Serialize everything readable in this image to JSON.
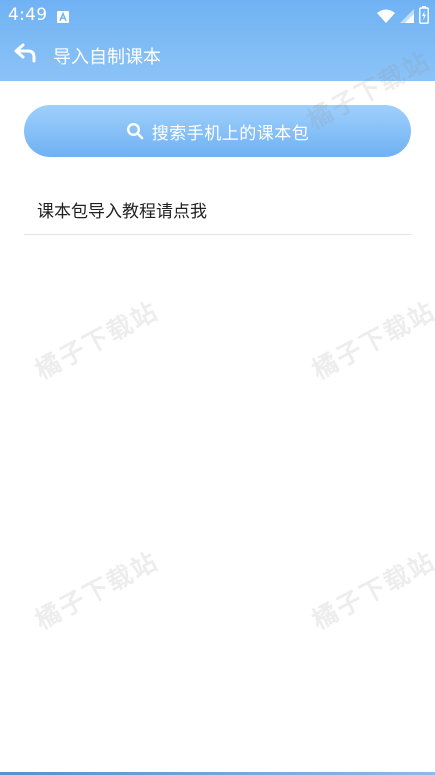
{
  "status_bar": {
    "time": "4:49",
    "icons": [
      "android-notification-icon",
      "wifi-icon",
      "signal-icon",
      "battery-icon"
    ]
  },
  "header": {
    "title": "导入自制课本",
    "back_icon": "back-arrow-icon"
  },
  "search": {
    "label": "搜索手机上的课本包",
    "icon": "search-icon"
  },
  "list": {
    "items": [
      {
        "label": "课本包导入教程请点我"
      }
    ]
  },
  "watermark": {
    "text": "橘子下载站"
  },
  "colors": {
    "accent": "#6fb2f4",
    "header_gradient_end": "#8cc3f7",
    "button_gradient_top": "#9fd0fb",
    "divider": "#e3e3e3",
    "text": "#222222"
  }
}
